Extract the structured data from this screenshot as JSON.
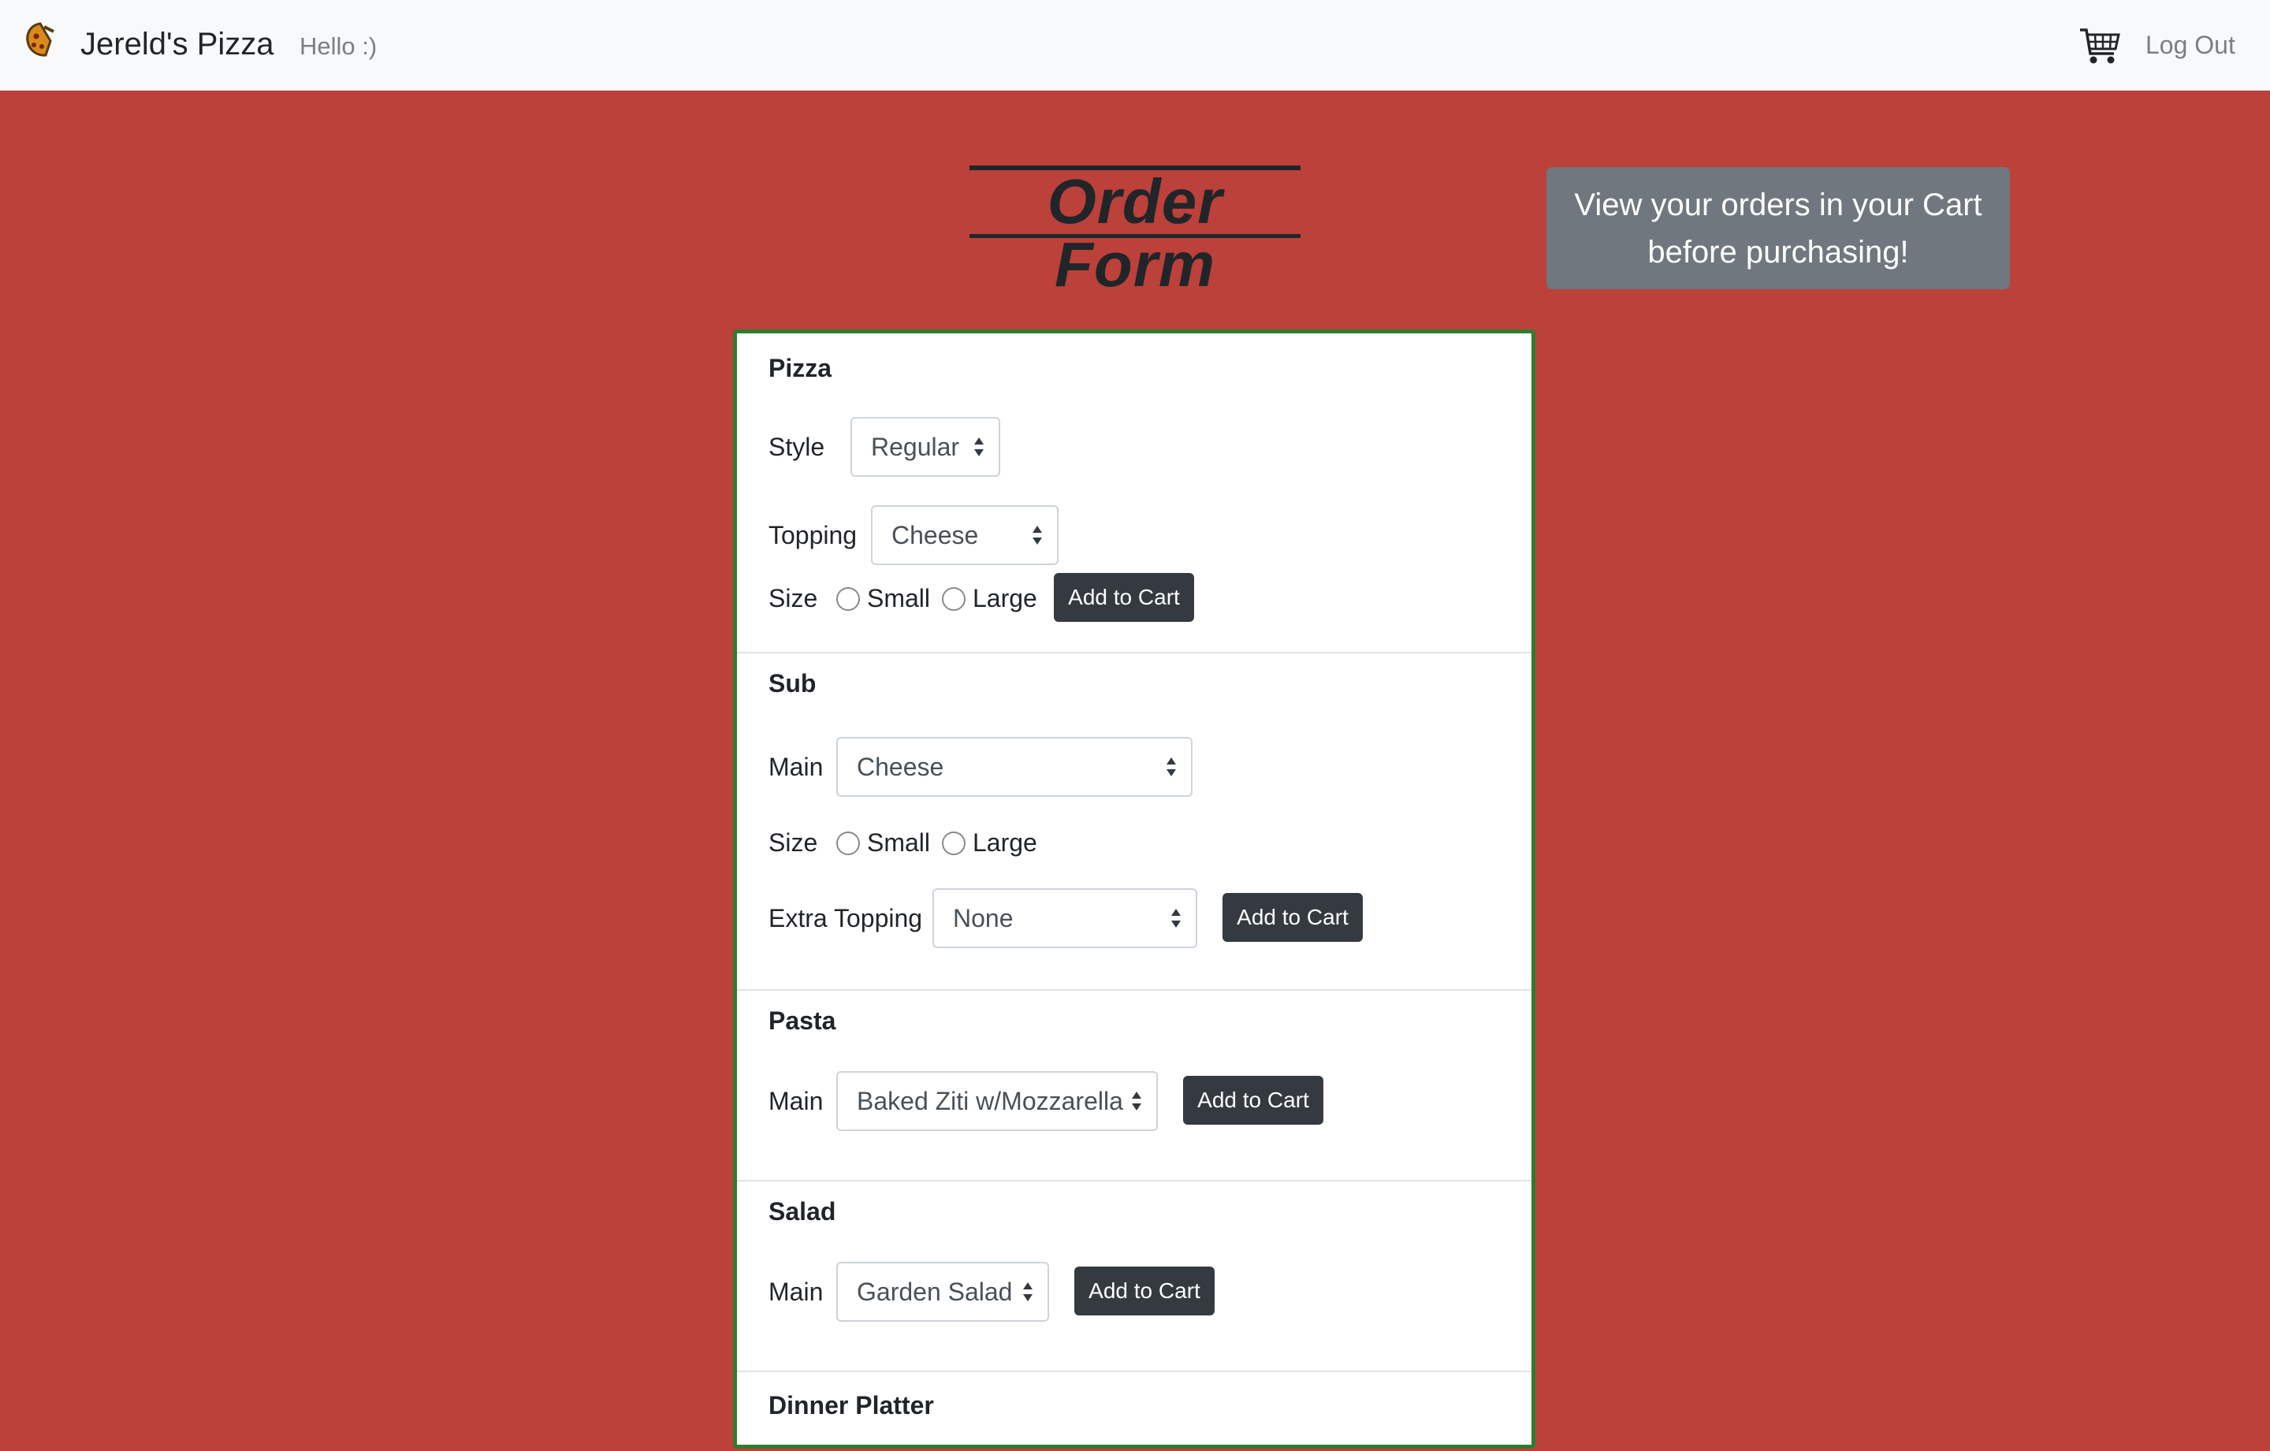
{
  "navbar": {
    "brand": "Jereld's Pizza",
    "greeting": "Hello :)",
    "logout_label": "Log Out"
  },
  "page": {
    "title": "Order Form",
    "cart_note": "View your orders in your Cart before purchasing!"
  },
  "sections": {
    "pizza": {
      "title": "Pizza",
      "style_label": "Style",
      "style_value": "Regular",
      "topping_label": "Topping",
      "topping_value": "Cheese",
      "size_label": "Size",
      "size_small": "Small",
      "size_large": "Large",
      "add_label": "Add to Cart"
    },
    "sub": {
      "title": "Sub",
      "main_label": "Main",
      "main_value": "Cheese",
      "size_label": "Size",
      "size_small": "Small",
      "size_large": "Large",
      "extra_label": "Extra Topping",
      "extra_value": "None",
      "add_label": "Add to Cart"
    },
    "pasta": {
      "title": "Pasta",
      "main_label": "Main",
      "main_value": "Baked Ziti w/Mozzarella",
      "add_label": "Add to Cart"
    },
    "salad": {
      "title": "Salad",
      "main_label": "Main",
      "main_value": "Garden Salad",
      "add_label": "Add to Cart"
    },
    "dinner": {
      "title": "Dinner Platter"
    }
  },
  "colors": {
    "background": "#bb413a",
    "navbar": "#f8f9fa",
    "card_border": "#2e7d2e",
    "button": "#343a40",
    "note": "#70777e"
  },
  "icons": {
    "logo": "pizza-logo-icon",
    "cart": "shopping-cart-icon",
    "select_arrows": "select-arrows-icon"
  }
}
